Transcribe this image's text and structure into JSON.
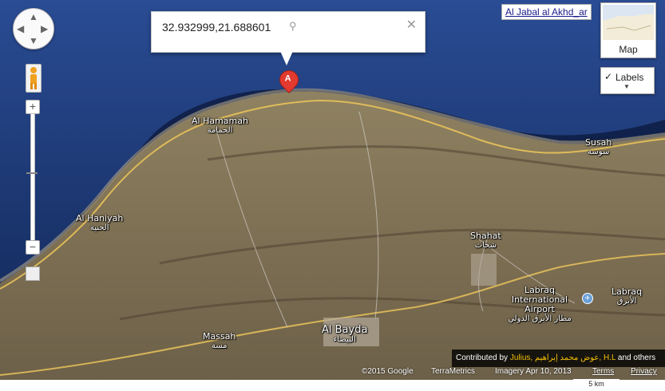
{
  "search": {
    "query": "32.932999,21.688601"
  },
  "marker": {
    "label": "A"
  },
  "top_link": "Al Jabal al Akhd_ar",
  "map_type_button": {
    "label": "Map"
  },
  "labels_toggle": {
    "check": "✓",
    "label": "Labels"
  },
  "places": [
    {
      "name": "Al Hamamah",
      "arabic": "الحمامة"
    },
    {
      "name": "Susah",
      "arabic": "سوسة"
    },
    {
      "name": "Al Haniyah",
      "arabic": "الحنية"
    },
    {
      "name": "Shahat",
      "arabic": "شحات"
    },
    {
      "name": "Labraq International Airport",
      "arabic": "مطار الأبرق الدولي"
    },
    {
      "name": "Labraq",
      "arabic": "الأبرق"
    },
    {
      "name": "Al Bayda",
      "arabic": "البيضاء"
    },
    {
      "name": "Massah",
      "arabic": "مسة"
    }
  ],
  "attribution": {
    "prefix": "Contributed by",
    "contributors": "Julius, عوض محمد إبراهيم, H.L",
    "suffix": "and others"
  },
  "footer": {
    "copyright": "©2015 Google",
    "terrametrics": "TerraMetrics",
    "imagery": "Imagery Apr 10, 2013",
    "terms": "Terms",
    "privacy": "Privacy"
  },
  "scale": {
    "label": "5 km"
  },
  "colors": {
    "sea": "#1c3a78",
    "land": "#8a7a5c",
    "marker": "#e23a2f",
    "road": "#e8c25a"
  }
}
